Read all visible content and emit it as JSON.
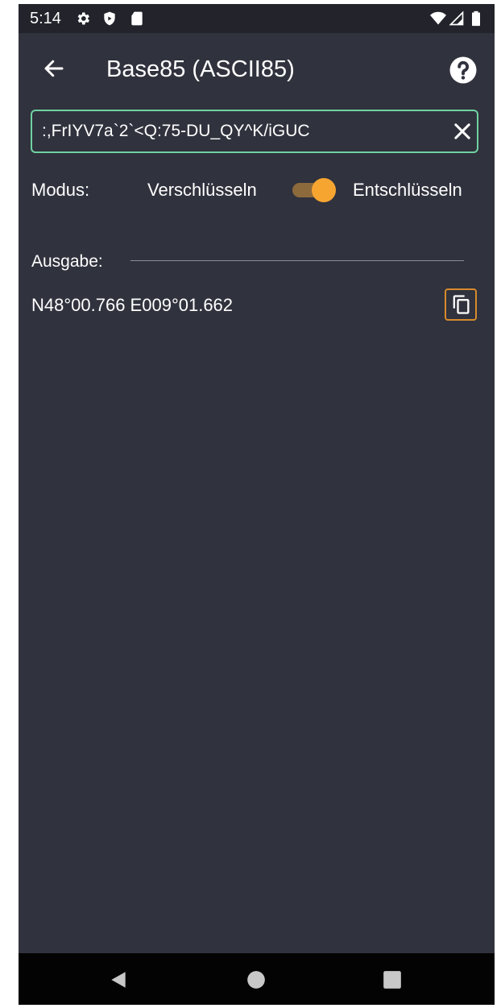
{
  "status_bar": {
    "time": "5:14",
    "icons": [
      "settings-icon",
      "shield-icon",
      "sd-card-icon",
      "wifi-icon",
      "signal-icon",
      "battery-icon"
    ]
  },
  "app_bar": {
    "title": "Base85 (ASCII85)",
    "back_icon": "arrow-left-icon",
    "help_icon": "help-circle-icon"
  },
  "input": {
    "value": ":,FrIYV7a`2`<Q:75-DU_QY^K/iGUC",
    "clear_icon": "close-icon"
  },
  "mode": {
    "label": "Modus:",
    "encrypt_label": "Verschlüsseln",
    "decrypt_label": "Entschlüsseln",
    "selected": "Entschlüsseln"
  },
  "output": {
    "label": "Ausgabe:",
    "value": "N48°00.766 E009°01.662",
    "copy_icon": "copy-icon"
  },
  "colors": {
    "background": "#30323d",
    "status_bar": "#22232b",
    "input_border": "#6fd2a3",
    "accent": "#f7a531",
    "toggle_track": "#8d6a3c",
    "copy_border": "#d78b2c",
    "nav_bar": "#030303"
  },
  "nav_bar": {
    "icons": [
      "nav-back-icon",
      "nav-home-icon",
      "nav-recents-icon"
    ]
  }
}
